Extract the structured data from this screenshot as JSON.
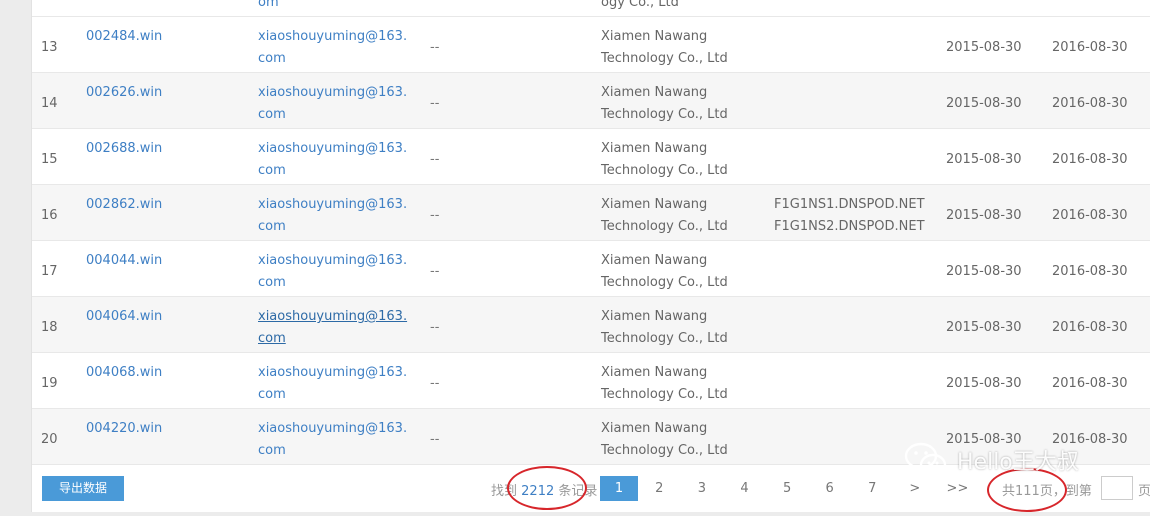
{
  "top_fragment": {
    "email_tail": "om",
    "company_tail": "ogy Co., Ltd"
  },
  "rows": [
    {
      "index": "13",
      "domain": "002484.win",
      "email": "xiaoshouyuming@163.com",
      "dash": "--",
      "company": "Xiamen Nawang Technology Co., Ltd",
      "nameservers": "",
      "created": "2015-08-30",
      "expires": "2016-08-30"
    },
    {
      "index": "14",
      "domain": "002626.win",
      "email": "xiaoshouyuming@163.com",
      "dash": "--",
      "company": "Xiamen Nawang Technology Co., Ltd",
      "nameservers": "",
      "created": "2015-08-30",
      "expires": "2016-08-30"
    },
    {
      "index": "15",
      "domain": "002688.win",
      "email": "xiaoshouyuming@163.com",
      "dash": "--",
      "company": "Xiamen Nawang Technology Co., Ltd",
      "nameservers": "",
      "created": "2015-08-30",
      "expires": "2016-08-30"
    },
    {
      "index": "16",
      "domain": "002862.win",
      "email": "xiaoshouyuming@163.com",
      "dash": "--",
      "company": "Xiamen Nawang Technology Co., Ltd",
      "nameservers": "F1G1NS1.DNSPOD.NET\nF1G1NS2.DNSPOD.NET",
      "created": "2015-08-30",
      "expires": "2016-08-30"
    },
    {
      "index": "17",
      "domain": "004044.win",
      "email": "xiaoshouyuming@163.com",
      "dash": "--",
      "company": "Xiamen Nawang Technology Co., Ltd",
      "nameservers": "",
      "created": "2015-08-30",
      "expires": "2016-08-30"
    },
    {
      "index": "18",
      "domain": "004064.win",
      "email": "xiaoshouyuming@163.com",
      "dash": "--",
      "company": "Xiamen Nawang Technology Co., Ltd",
      "nameservers": "",
      "created": "2015-08-30",
      "expires": "2016-08-30"
    },
    {
      "index": "19",
      "domain": "004068.win",
      "email": "xiaoshouyuming@163.com",
      "dash": "--",
      "company": "Xiamen Nawang Technology Co., Ltd",
      "nameservers": "",
      "created": "2015-08-30",
      "expires": "2016-08-30"
    },
    {
      "index": "20",
      "domain": "004220.win",
      "email": "xiaoshouyuming@163.com",
      "dash": "--",
      "company": "Xiamen Nawang Technology Co., Ltd",
      "nameservers": "",
      "created": "2015-08-30",
      "expires": "2016-08-30"
    }
  ],
  "footer": {
    "export_label": "导出数据",
    "found_prefix": "找到",
    "found_count": "2212",
    "found_suffix": "条记录",
    "pages": [
      "1",
      "2",
      "3",
      "4",
      "5",
      "6",
      "7",
      ">",
      ">>"
    ],
    "current_page": "1",
    "total_pages_text": "共111页，到第",
    "page_unit": "页"
  },
  "watermark": {
    "text": "Hello王大叔",
    "icon": "wechat-icon"
  },
  "colors": {
    "link": "#3e7fc4",
    "button": "#4a9ad8",
    "annotation": "#d7262b"
  }
}
